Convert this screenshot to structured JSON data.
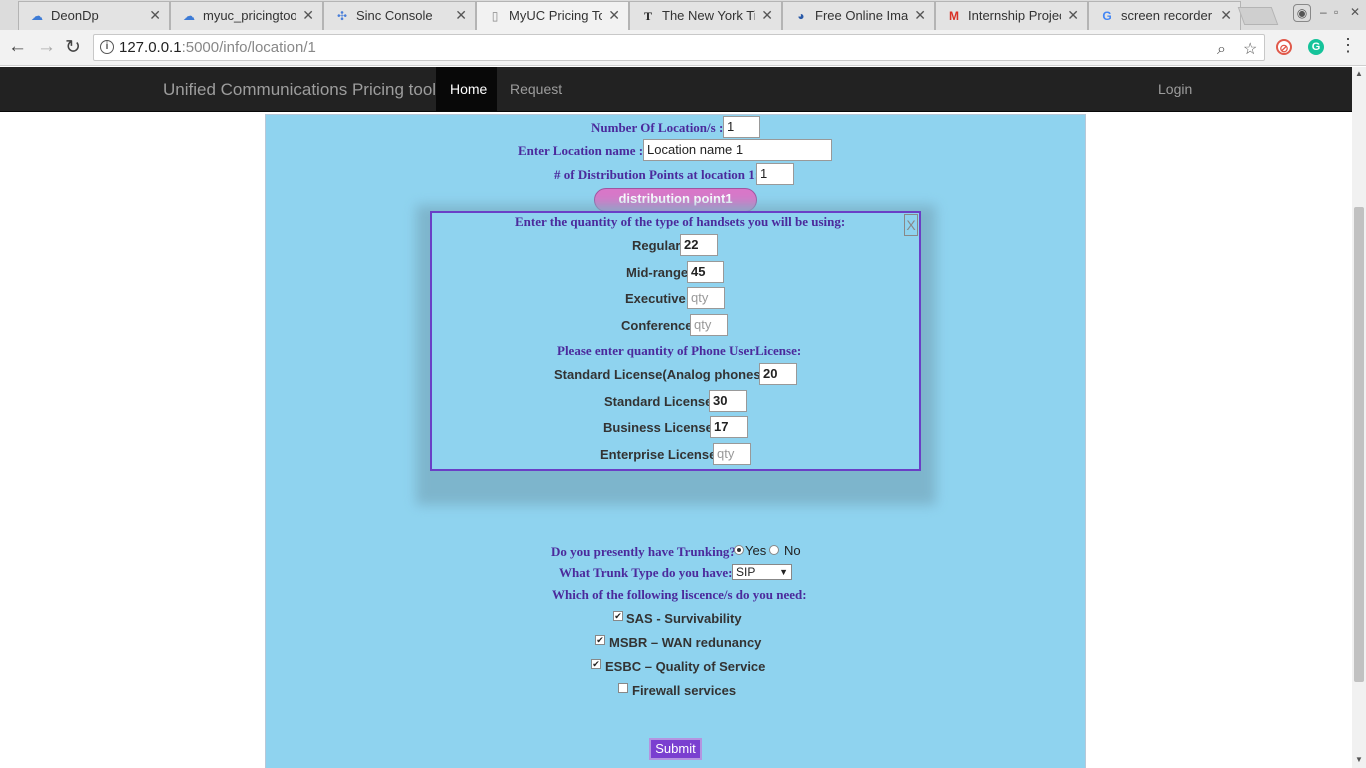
{
  "browser": {
    "tabs": [
      {
        "title": "DeonDp",
        "icon": "cloud-icon",
        "color": "#3d7bd6",
        "glyph": "☁"
      },
      {
        "title": "myuc_pricingtool",
        "icon": "cloud-icon",
        "color": "#3d7bd6",
        "glyph": "☁"
      },
      {
        "title": "Sinc Console",
        "icon": "sinc-icon",
        "color": "#4a7fd9",
        "glyph": "✣"
      },
      {
        "title": "MyUC Pricing Tool",
        "icon": "page-icon",
        "color": "#888888",
        "glyph": "▯"
      },
      {
        "title": "The New York Times",
        "icon": "nyt-icon",
        "color": "#222222",
        "glyph": "T"
      },
      {
        "title": "Free Online Image",
        "icon": "image-site-icon",
        "color": "#2a5aa8",
        "glyph": "◕"
      },
      {
        "title": "Internship Project",
        "icon": "gmail-icon",
        "color": "#d93025",
        "glyph": "M"
      },
      {
        "title": "screen recorder",
        "icon": "google-icon",
        "color": "#4285f4",
        "glyph": "G"
      }
    ],
    "close_glyph": "✕",
    "url_host": "127.0.0.1",
    "url_path": ":5000/info/location/1",
    "window_controls": {
      "minimize": "–",
      "maximize": "▫",
      "close": "✕"
    }
  },
  "navbar": {
    "brand": "Unified Communications Pricing tool",
    "links": [
      "Home",
      "Request",
      "Login"
    ]
  },
  "form": {
    "locations_label": "Number Of Location/s :",
    "locations_value": "1",
    "location_name_label": "Enter Location name :",
    "location_name_value": "Location name 1",
    "dist_points_label": "# of Distribution Points at location 1:",
    "dist_points_value": "1",
    "dist_point_button": "distribution point1"
  },
  "modal": {
    "close": "X",
    "handsets_heading": "Enter the quantity of the type of handsets you will be using:",
    "handsets": [
      {
        "label": "Regular",
        "value": "22",
        "placeholder": "qty"
      },
      {
        "label": "Mid-range",
        "value": "45",
        "placeholder": "qty"
      },
      {
        "label": "Executive",
        "value": "",
        "placeholder": "qty"
      },
      {
        "label": "Conference",
        "value": "",
        "placeholder": "qty"
      }
    ],
    "license_heading": "Please enter quantity of Phone UserLicense:",
    "licenses": [
      {
        "label": "Standard License(Analog phones)",
        "value": "20",
        "placeholder": "qty"
      },
      {
        "label": "Standard License",
        "value": "30",
        "placeholder": "qty"
      },
      {
        "label": "Business License",
        "value": "17",
        "placeholder": "qty"
      },
      {
        "label": "Enterprise License",
        "value": "",
        "placeholder": "qty"
      }
    ]
  },
  "trunking": {
    "question": "Do you presently have Trunking?",
    "yes": "Yes",
    "no": "No",
    "selected": "Yes",
    "type_label": "What Trunk Type do you have:",
    "type_value": "SIP",
    "licences_label": "Which of the following liscence/s do you need:",
    "options": [
      {
        "label": "SAS - Survivability",
        "checked": true
      },
      {
        "label": "MSBR – WAN redunancy",
        "checked": true
      },
      {
        "label": "ESBC – Quality of Service",
        "checked": true
      },
      {
        "label": "Firewall services",
        "checked": false
      }
    ]
  },
  "submit_label": "Submit",
  "colors": {
    "panel": "#8fd3ef",
    "label_purple": "#4b2a9c",
    "modal_border": "#6a3fc6",
    "pill": "#d877c8",
    "submit": "#7a3fd0",
    "navbar": "#222222"
  }
}
